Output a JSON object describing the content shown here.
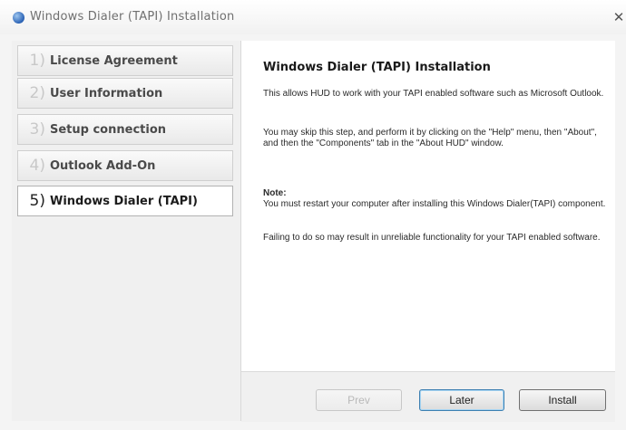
{
  "window": {
    "title": "Windows Dialer (TAPI) Installation",
    "close_glyph": "✕",
    "icon": "app-globe-icon"
  },
  "sidebar": {
    "steps": [
      {
        "number": "1)",
        "label": "License Agreement",
        "active": false
      },
      {
        "number": "2)",
        "label": "User Information",
        "active": false
      },
      {
        "number": "3)",
        "label": "Setup connection",
        "active": false
      },
      {
        "number": "4)",
        "label": "Outlook Add-On",
        "active": false
      },
      {
        "number": "5)",
        "label": "Windows Dialer (TAPI)",
        "active": true
      }
    ]
  },
  "main": {
    "title": "Windows Dialer (TAPI) Installation",
    "paragraph1": "This allows HUD to work with your TAPI enabled software such as Microsoft Outlook.",
    "paragraph2": "You may skip this step, and perform it by clicking on the \"Help\" menu, then \"About\", and then the \"Components\" tab in the \"About HUD\" window.",
    "note_heading": "Note:",
    "note_text": "You must restart your computer after installing this Windows Dialer(TAPI) component.",
    "paragraph3": "Failing to do so may result in unreliable functionality for your TAPI enabled software."
  },
  "footer": {
    "prev_label": "Prev",
    "later_label": "Later",
    "install_label": "Install",
    "prev_disabled": true
  }
}
